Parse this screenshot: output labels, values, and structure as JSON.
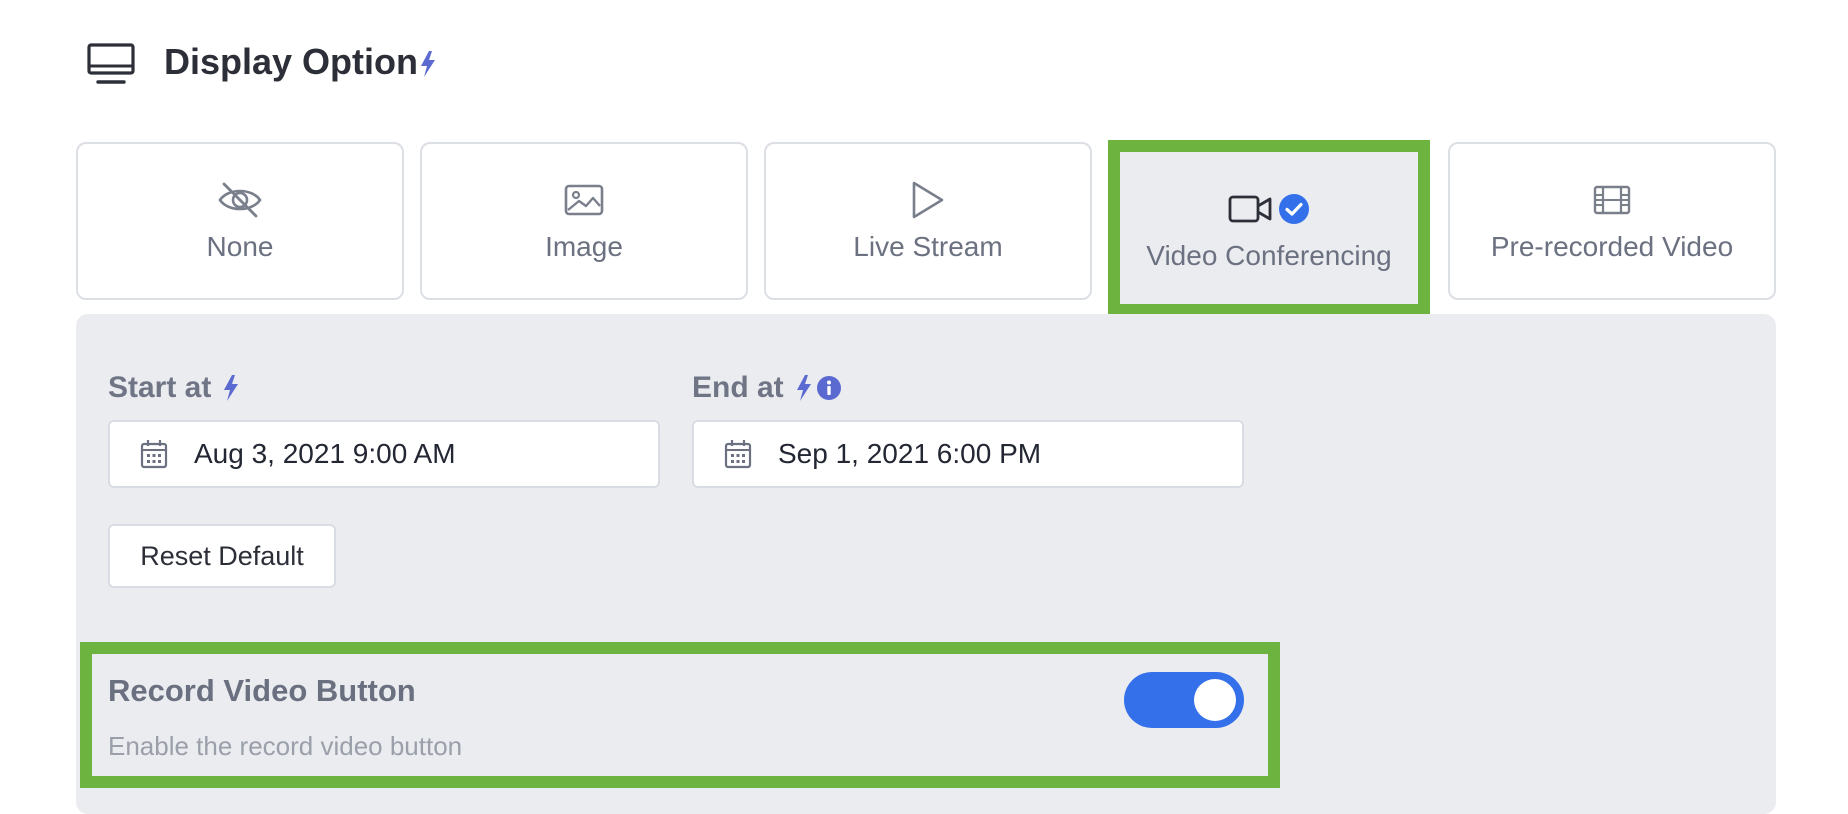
{
  "header": {
    "title": "Display Option",
    "icon": "monitor-icon"
  },
  "options": [
    {
      "label": "None",
      "icon": "eye-slash-icon",
      "selected": false
    },
    {
      "label": "Image",
      "icon": "image-icon",
      "selected": false
    },
    {
      "label": "Live Stream",
      "icon": "play-icon",
      "selected": false
    },
    {
      "label": "Video Conferencing",
      "icon": "video-camera-icon",
      "selected": true
    },
    {
      "label": "Pre-recorded Video",
      "icon": "film-icon",
      "selected": false
    }
  ],
  "schedule": {
    "start_label": "Start at",
    "start_value": "Aug 3, 2021 9:00 AM",
    "end_label": "End at",
    "end_value": "Sep 1, 2021 6:00 PM",
    "reset_label": "Reset Default"
  },
  "record": {
    "title": "Record Video Button",
    "description": "Enable the record video button",
    "enabled": true
  },
  "colors": {
    "accent_blue": "#3370ea",
    "bolt_purple": "#5b6ad0",
    "highlight_green": "#6db33f",
    "panel_bg": "#ebecf0"
  }
}
